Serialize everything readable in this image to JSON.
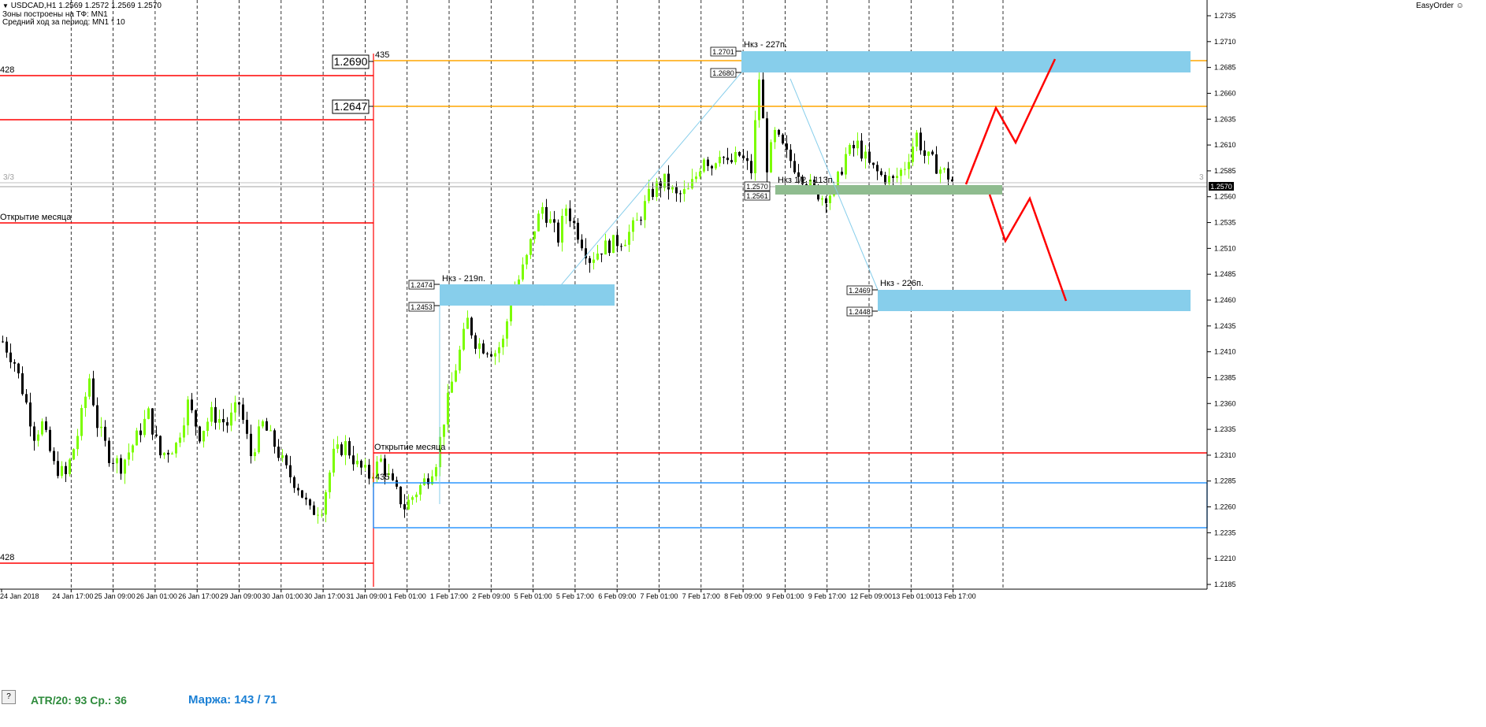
{
  "header": {
    "symbol_line": "USDCAD,H1  1.2569 1.2572 1.2569 1.2570",
    "zones_line": "Зоны построены на ТФ: MN1",
    "avg_line": "Средний ход за период: MN1 * 10"
  },
  "easy_order": "EasyOrder",
  "bottom_panel": {
    "help_button": "?",
    "atr_text": "ATR/20: 93  Ср.: 36",
    "margin_text": "Маржа: 143 / 71"
  },
  "chart_data": {
    "type": "candlestick",
    "title": "USDCAD,H1",
    "ylim": [
      1.2175,
      1.275
    ],
    "y_ticks": [
      "1.2735",
      "1.2710",
      "1.2685",
      "1.2660",
      "1.2635",
      "1.2610",
      "1.2585",
      "1.2560",
      "1.2535",
      "1.2510",
      "1.2485",
      "1.2460",
      "1.2435",
      "1.2410",
      "1.2385",
      "1.2360",
      "1.2335",
      "1.2310",
      "1.2285",
      "1.2260",
      "1.2235",
      "1.2210",
      "1.2185"
    ],
    "x_ticks": [
      "24 Jan 2018",
      "24 Jan 17:00",
      "25 Jan 09:00",
      "26 Jan 01:00",
      "26 Jan 17:00",
      "29 Jan 09:00",
      "30 Jan 01:00",
      "30 Jan 17:00",
      "31 Jan 09:00",
      "1 Feb 01:00",
      "1 Feb 17:00",
      "2 Feb 09:00",
      "5 Feb 01:00",
      "5 Feb 17:00",
      "6 Feb 09:00",
      "7 Feb 01:00",
      "7 Feb 17:00",
      "8 Feb 09:00",
      "9 Feb 01:00",
      "9 Feb 17:00",
      "12 Feb 09:00",
      "13 Feb 01:00",
      "13 Feb 17:00"
    ],
    "current_price": "1.2570",
    "close_path": [
      [
        0,
        1.242
      ],
      [
        3,
        1.24
      ],
      [
        6,
        1.236
      ],
      [
        8,
        1.233
      ],
      [
        10,
        1.234
      ],
      [
        13,
        1.23
      ],
      [
        16,
        1.229
      ],
      [
        19,
        1.233
      ],
      [
        22,
        1.2385
      ],
      [
        24,
        1.234
      ],
      [
        27,
        1.231
      ],
      [
        30,
        1.23
      ],
      [
        33,
        1.232
      ],
      [
        37,
        1.235
      ],
      [
        40,
        1.231
      ],
      [
        44,
        1.232
      ],
      [
        47,
        1.236
      ],
      [
        50,
        1.233
      ],
      [
        53,
        1.235
      ],
      [
        57,
        1.234
      ],
      [
        60,
        1.236
      ],
      [
        63,
        1.231
      ],
      [
        66,
        1.234
      ],
      [
        69,
        1.232
      ],
      [
        72,
        1.2295
      ],
      [
        75,
        1.228
      ],
      [
        78,
        1.2255
      ],
      [
        81,
        1.226
      ],
      [
        84,
        1.231
      ],
      [
        87,
        1.232
      ],
      [
        90,
        1.23
      ],
      [
        93,
        1.229
      ],
      [
        96,
        1.2305
      ],
      [
        99,
        1.228
      ],
      [
        102,
        1.226
      ],
      [
        105,
        1.2275
      ],
      [
        108,
        1.229
      ],
      [
        110,
        1.2305
      ],
      [
        112,
        1.2345
      ],
      [
        114,
        1.238
      ],
      [
        116,
        1.241
      ],
      [
        118,
        1.244
      ],
      [
        120,
        1.242
      ],
      [
        122,
        1.2415
      ],
      [
        125,
        1.241
      ],
      [
        127,
        1.242
      ],
      [
        129,
        1.246
      ],
      [
        131,
        1.248
      ],
      [
        133,
        1.25
      ],
      [
        135,
        1.253
      ],
      [
        137,
        1.255
      ],
      [
        139,
        1.2535
      ],
      [
        141,
        1.252
      ],
      [
        143,
        1.255
      ],
      [
        146,
        1.2525
      ],
      [
        149,
        1.25
      ],
      [
        152,
        1.251
      ],
      [
        155,
        1.2515
      ],
      [
        158,
        1.252
      ],
      [
        161,
        1.2535
      ],
      [
        164,
        1.256
      ],
      [
        166,
        1.257
      ],
      [
        168,
        1.2575
      ],
      [
        171,
        1.256
      ],
      [
        174,
        1.2565
      ],
      [
        176,
        1.258
      ],
      [
        178,
        1.26
      ],
      [
        180,
        1.259
      ],
      [
        182,
        1.2605
      ],
      [
        184,
        1.259
      ],
      [
        187,
        1.26
      ],
      [
        190,
        1.2585
      ],
      [
        192,
        1.2675
      ],
      [
        194,
        1.259
      ],
      [
        196,
        1.262
      ],
      [
        199,
        1.26
      ],
      [
        202,
        1.2585
      ],
      [
        205,
        1.257
      ],
      [
        208,
        1.256
      ],
      [
        211,
        1.2565
      ],
      [
        214,
        1.26
      ],
      [
        217,
        1.261
      ],
      [
        220,
        1.259
      ],
      [
        223,
        1.258
      ],
      [
        226,
        1.2575
      ],
      [
        229,
        1.259
      ],
      [
        232,
        1.262
      ],
      [
        234,
        1.26
      ],
      [
        237,
        1.259
      ],
      [
        240,
        1.258
      ],
      [
        242,
        1.257
      ]
    ],
    "zones": [
      {
        "label": "Нкз - 227п.",
        "upper": "1.2701",
        "lower": "1.2680",
        "color": "#87ceeb"
      },
      {
        "label": "Нкз - 219п.",
        "upper": "1.2474",
        "lower": "1.2453",
        "color": "#87ceeb"
      },
      {
        "label": "Нкз - 226п.",
        "upper": "1.2469",
        "lower": "1.2448",
        "color": "#87ceeb"
      },
      {
        "label": "Нкз 1/2 - 113п.",
        "upper": "1.2570",
        "lower": "1.2561",
        "color": "#8fbc8f"
      }
    ],
    "levels": [
      {
        "label": "1.2690",
        "color": "#ffa500"
      },
      {
        "label": "1.2647",
        "color": "#ffa500"
      }
    ],
    "annotations": [
      "428",
      "435",
      "Открытие месяца",
      "3/3",
      "3"
    ],
    "colors": {
      "bull": "#7cfc00",
      "bear": "#000000",
      "level": "#ff0000",
      "box": "#1e90ff",
      "forecast": "#ff0000"
    }
  }
}
